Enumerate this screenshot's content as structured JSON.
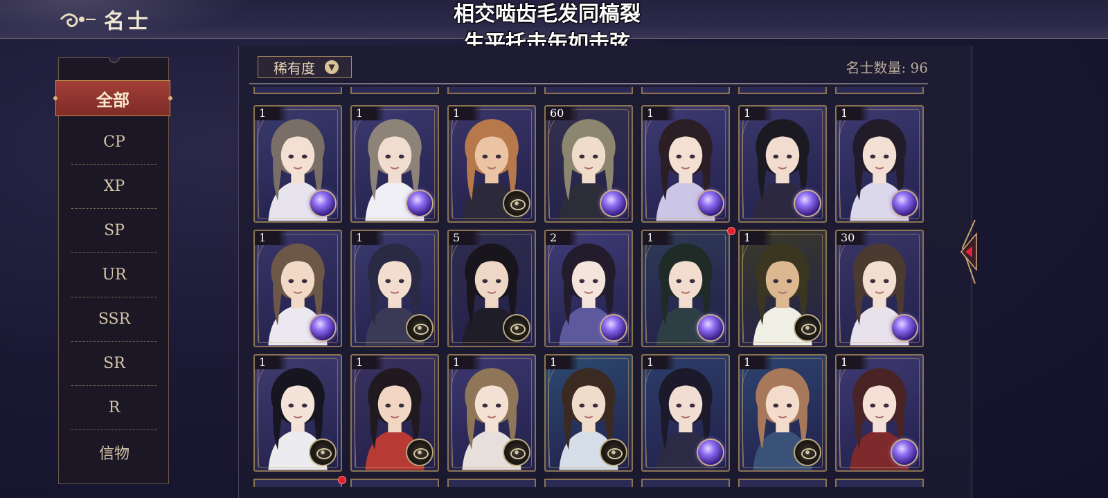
{
  "header": {
    "title": "名士",
    "caption_line1": "相交啮齿毛发同槁裂",
    "caption_line2": "生平托击缶如击弦"
  },
  "sidebar": {
    "active": "全部",
    "items": [
      "CP",
      "XP",
      "SP",
      "UR",
      "SSR",
      "SR",
      "R",
      "信物"
    ]
  },
  "toolbar": {
    "rarity_label": "稀有度",
    "count_label": "名士数量: 96"
  },
  "colors": {
    "accent_red": "#a23e36",
    "gold": "#c9924e",
    "panel": "#1e1c33"
  },
  "cards": [
    {
      "level": "1",
      "orb": "purple",
      "hair": "#7a6f66",
      "skin": "#f3e0d3",
      "cloth": "#e7e4ee",
      "bg": "#3a3a6e"
    },
    {
      "level": "1",
      "orb": "purple",
      "hair": "#8d8378",
      "skin": "#f1ddcf",
      "cloth": "#efeff5",
      "bg": "#3c3a70"
    },
    {
      "level": "1",
      "orb": "dark",
      "hair": "#b7794c",
      "skin": "#eac4a3",
      "cloth": "#2c2a3a",
      "bg": "#3a3568"
    },
    {
      "level": "60",
      "orb": "purple",
      "hair": "#8c8670",
      "skin": "#f0dccb",
      "cloth": "#2d2d3a",
      "bg": "#34314f"
    },
    {
      "level": "1",
      "orb": "purple",
      "hair": "#2b1e24",
      "skin": "#f4dfd3",
      "cloth": "#ccc6e6",
      "bg": "#3e3b74"
    },
    {
      "level": "1",
      "orb": "purple",
      "hair": "#1b1a22",
      "skin": "#f1dccf",
      "cloth": "#2b2840",
      "bg": "#3b386c"
    },
    {
      "level": "1",
      "orb": "purple",
      "hair": "#221c2a",
      "skin": "#f3e0d4",
      "cloth": "#dcd8ec",
      "bg": "#3d3a70"
    },
    {
      "level": "1",
      "orb": "purple",
      "hair": "#6d5746",
      "skin": "#f1d9c6",
      "cloth": "#ebe8f0",
      "bg": "#393669"
    },
    {
      "level": "1",
      "orb": "dark",
      "hair": "#2a2a44",
      "skin": "#f2ddcf",
      "cloth": "#3a3a56",
      "bg": "#3a3a6e"
    },
    {
      "level": "5",
      "orb": "dark",
      "hair": "#18151c",
      "skin": "#efd7c6",
      "cloth": "#1f1d28",
      "bg": "#2f2d4c"
    },
    {
      "level": "2",
      "orb": "purple",
      "hair": "#221c2c",
      "skin": "#f5e4db",
      "cloth": "#5c5a9c",
      "bg": "#3f3c78"
    },
    {
      "level": "1",
      "orb": "purple",
      "hair": "#1f2b26",
      "skin": "#f1dccd",
      "cloth": "#2d3e44",
      "bg": "#2f3a56"
    },
    {
      "level": "1",
      "orb": "dark",
      "hair": "#3b3620",
      "skin": "#dcb891",
      "cloth": "#f0efe6",
      "bg": "#3a3a2a"
    },
    {
      "level": "30",
      "orb": "purple",
      "hair": "#4a3a30",
      "skin": "#f3dfd1",
      "cloth": "#e8e2ec",
      "bg": "#3a3668"
    },
    {
      "level": "1",
      "orb": "dark",
      "hair": "#171520",
      "skin": "#f4e3d8",
      "cloth": "#ecebee",
      "bg": "#403c70"
    },
    {
      "level": "1",
      "orb": "dark",
      "hair": "#201a20",
      "skin": "#f1d6c3",
      "cloth": "#b83a34",
      "bg": "#3a3260"
    },
    {
      "level": "1",
      "orb": "dark",
      "hair": "#8f7658",
      "skin": "#f3e2d3",
      "cloth": "#e6dfdb",
      "bg": "#3c3870"
    },
    {
      "level": "1",
      "orb": "dark",
      "hair": "#3a2a22",
      "skin": "#f0dccb",
      "cloth": "#d4dde8",
      "bg": "#2c4a70"
    },
    {
      "level": "1",
      "orb": "purple",
      "hair": "#1c1a2a",
      "skin": "#f1ddd1",
      "cloth": "#2c2a44",
      "bg": "#2c3e6a"
    },
    {
      "level": "1",
      "orb": "dark",
      "hair": "#a7795a",
      "skin": "#f3dccb",
      "cloth": "#3a5278",
      "bg": "#2d4470"
    },
    {
      "level": "1",
      "orb": "purple",
      "hair": "#4a2324",
      "skin": "#f4e0d5",
      "cloth": "#7e2a2c",
      "bg": "#3e3a72"
    }
  ]
}
